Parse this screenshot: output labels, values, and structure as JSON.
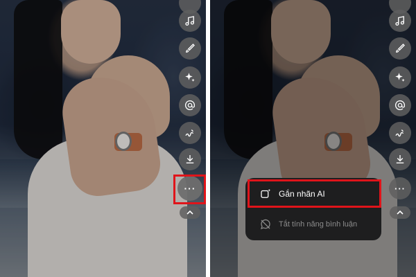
{
  "actions": [
    {
      "id": "music",
      "icon": "music-note-icon"
    },
    {
      "id": "edit",
      "icon": "brush-icon"
    },
    {
      "id": "effects",
      "icon": "sparkles-icon"
    },
    {
      "id": "mention",
      "icon": "at-sign-icon"
    },
    {
      "id": "draw",
      "icon": "squiggle-icon"
    },
    {
      "id": "download",
      "icon": "download-icon"
    }
  ],
  "more_button": {
    "glyph": "···",
    "icon": "more-icon"
  },
  "collapse_button": {
    "icon": "chevron-up-icon"
  },
  "menu": {
    "items": [
      {
        "label": "Gắn nhãn AI",
        "icon": "ai-label-icon",
        "enabled": true
      },
      {
        "label": "Tắt tính năng bình luận",
        "icon": "comment-off-icon",
        "enabled": false
      }
    ]
  },
  "colors": {
    "highlight": "#e0141a",
    "button_bg": "#5f5f5f",
    "menu_bg": "#1e1e1f"
  }
}
